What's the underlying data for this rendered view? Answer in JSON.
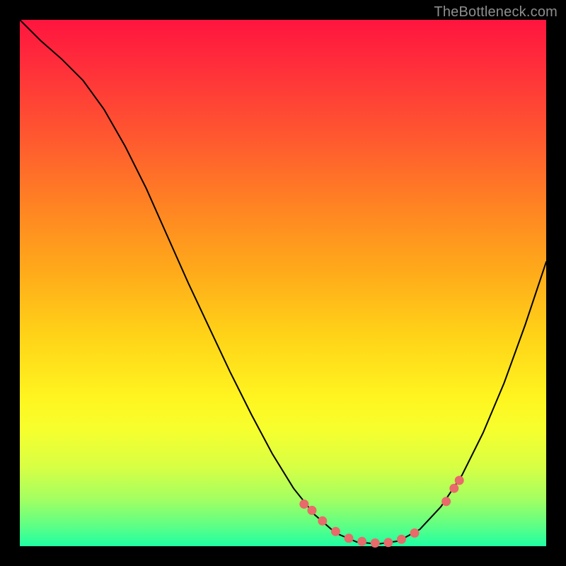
{
  "watermark": "TheBottleneck.com",
  "colors": {
    "curve": "#000000",
    "dot": "#e86a6a"
  },
  "chart_data": {
    "type": "line",
    "title": "",
    "xlabel": "",
    "ylabel": "",
    "xlim": [
      0,
      100
    ],
    "ylim": [
      0,
      100
    ],
    "grid": false,
    "legend": false,
    "curve": [
      {
        "x": 0.0,
        "y": 100.0
      },
      {
        "x": 4.0,
        "y": 96.0
      },
      {
        "x": 8.0,
        "y": 92.5
      },
      {
        "x": 12.0,
        "y": 88.5
      },
      {
        "x": 16.0,
        "y": 83.0
      },
      {
        "x": 20.0,
        "y": 76.0
      },
      {
        "x": 24.0,
        "y": 68.0
      },
      {
        "x": 28.0,
        "y": 59.0
      },
      {
        "x": 32.0,
        "y": 50.0
      },
      {
        "x": 36.0,
        "y": 41.5
      },
      {
        "x": 40.0,
        "y": 33.0
      },
      {
        "x": 44.0,
        "y": 25.0
      },
      {
        "x": 48.0,
        "y": 17.5
      },
      {
        "x": 52.0,
        "y": 11.0
      },
      {
        "x": 56.0,
        "y": 6.0
      },
      {
        "x": 60.0,
        "y": 2.5
      },
      {
        "x": 64.0,
        "y": 0.8
      },
      {
        "x": 68.0,
        "y": 0.4
      },
      {
        "x": 72.0,
        "y": 1.0
      },
      {
        "x": 76.0,
        "y": 3.2
      },
      {
        "x": 80.0,
        "y": 7.5
      },
      {
        "x": 84.0,
        "y": 13.5
      },
      {
        "x": 88.0,
        "y": 21.5
      },
      {
        "x": 92.0,
        "y": 31.0
      },
      {
        "x": 96.0,
        "y": 42.0
      },
      {
        "x": 100.0,
        "y": 54.0
      }
    ],
    "dots": [
      {
        "x": 54.0,
        "y": 8.0
      },
      {
        "x": 55.5,
        "y": 6.8
      },
      {
        "x": 57.5,
        "y": 4.8
      },
      {
        "x": 60.0,
        "y": 2.8
      },
      {
        "x": 62.5,
        "y": 1.5
      },
      {
        "x": 65.0,
        "y": 0.9
      },
      {
        "x": 67.5,
        "y": 0.6
      },
      {
        "x": 70.0,
        "y": 0.7
      },
      {
        "x": 72.5,
        "y": 1.3
      },
      {
        "x": 75.0,
        "y": 2.5
      },
      {
        "x": 81.0,
        "y": 8.5
      },
      {
        "x": 82.5,
        "y": 11.0
      },
      {
        "x": 83.5,
        "y": 12.5
      }
    ]
  }
}
